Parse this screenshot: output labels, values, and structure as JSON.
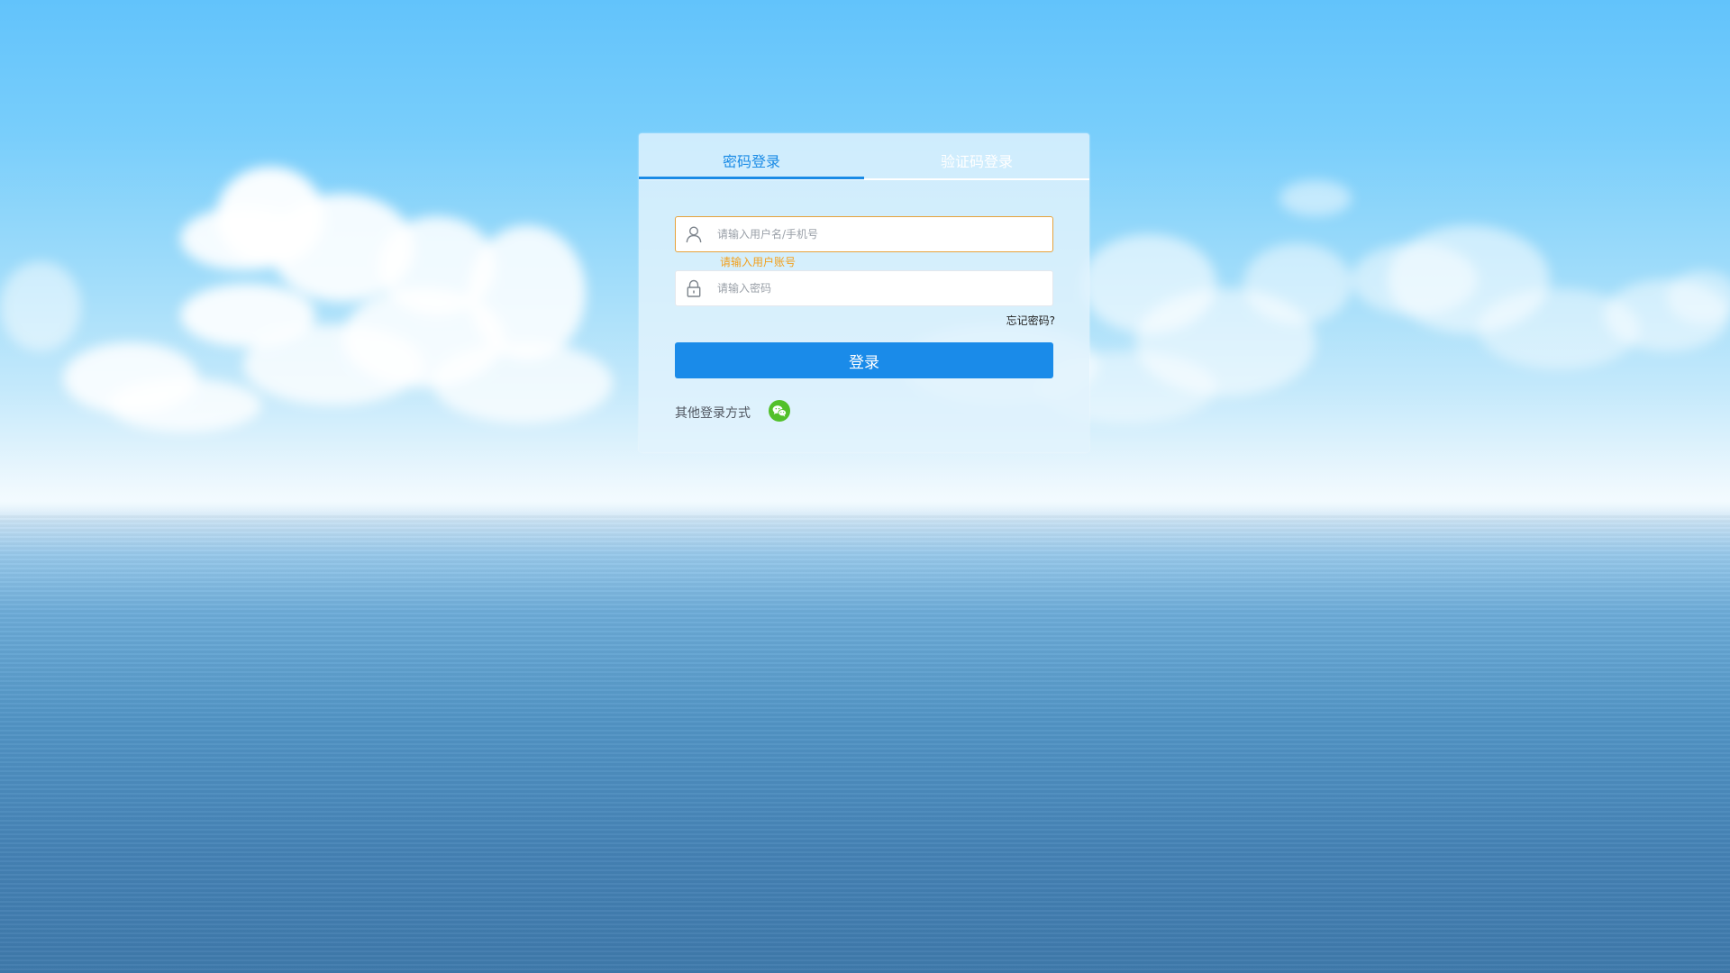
{
  "tabs": [
    {
      "label": "密码登录",
      "active": true
    },
    {
      "label": "验证码登录",
      "active": false
    }
  ],
  "username": {
    "value": "",
    "placeholder": "请输入用户名/手机号",
    "icon": "user-icon",
    "error": "请输入用户账号"
  },
  "password": {
    "value": "",
    "placeholder": "请输入密码",
    "icon": "lock-icon"
  },
  "forgot_label": "忘记密码?",
  "login_label": "登录",
  "other_login": {
    "label": "其他登录方式",
    "icons": [
      "wechat-icon"
    ]
  },
  "colors": {
    "accent": "#1a8be9",
    "error": "#f2a01d",
    "wechat": "#52c02a"
  }
}
